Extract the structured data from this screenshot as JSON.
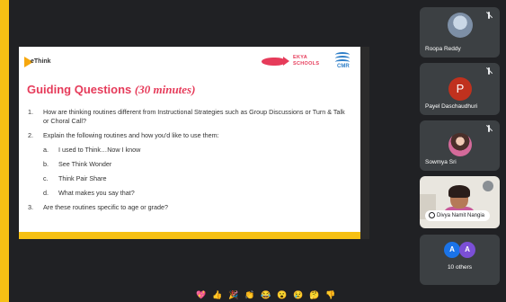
{
  "slide": {
    "title": "Guiding Questions",
    "duration": "(30 minutes)",
    "logo_think": "eThink",
    "ekya": {
      "line1": "EKYA",
      "line2": "SCHOOLS"
    },
    "cmr": "CMR",
    "questions": [
      {
        "num": "1.",
        "text": "How are thinking routines different from Instructional Strategies such as Group Discussions or Turn & Talk or Choral Call?"
      },
      {
        "num": "2.",
        "text": "Explain the following routines and how you'd like to use them:"
      },
      {
        "num": "3.",
        "text": "Are these routines specific to age or grade?"
      }
    ],
    "subitems": [
      {
        "num": "a.",
        "text": "I used to Think…Now I know"
      },
      {
        "num": "b.",
        "text": "See Think Wonder"
      },
      {
        "num": "c.",
        "text": "Think Pair Share"
      },
      {
        "num": "d.",
        "text": "What makes you say that?"
      }
    ]
  },
  "participants": [
    {
      "name": "Roopa Reddy",
      "muted": true
    },
    {
      "name": "Payel Daschaudhuri",
      "initial": "P",
      "muted": true
    },
    {
      "name": "Sowmya Sri",
      "muted": true
    },
    {
      "name": "Divya Namit Nangia",
      "muted": false
    },
    {
      "name": "10 others",
      "initials": [
        "A",
        "A"
      ]
    }
  ],
  "reactions": [
    "💖",
    "👍",
    "🎉",
    "👏",
    "😂",
    "😮",
    "😢",
    "🤔",
    "👎"
  ],
  "colors": {
    "accent": "#e63b5a",
    "frame": "#f6c014",
    "stage": "#202124"
  }
}
